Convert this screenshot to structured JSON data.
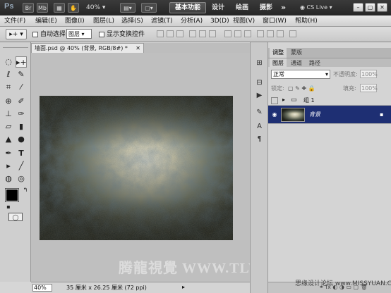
{
  "app": {
    "logo": "Ps",
    "zoom": "40%",
    "workspace_active": "基本功能",
    "workspaces": [
      "设计",
      "绘画",
      "摄影"
    ],
    "more": "»",
    "cs_live": "CS Live"
  },
  "menu": [
    "文件(F)",
    "编辑(E)",
    "图像(I)",
    "图层(L)",
    "选择(S)",
    "滤镜(T)",
    "分析(A)",
    "3D(D)",
    "视图(V)",
    "窗口(W)",
    "帮助(H)"
  ],
  "options": {
    "auto_select_label": "自动选择:",
    "auto_select_value": "图层",
    "show_transform_label": "显示变换控件"
  },
  "document": {
    "tab_title": "墙面.psd @ 40% (背景, RGB/8#) *",
    "zoom": "40%",
    "info": "35 厘米 x 26.25 厘米 (72 ppi)"
  },
  "watermark": "腾龍視覺 WWW.TLVI.NET",
  "watermark_small": "思缘设计论坛 www.MISSYUAN.COM",
  "panel": {
    "top_tabs": [
      "调整",
      "蒙版"
    ],
    "layer_tabs": [
      "图层",
      "通道",
      "路径"
    ],
    "blend_mode": "正常",
    "opacity_label": "不透明度:",
    "opacity": "100%",
    "lock_label": "锁定:",
    "fill_label": "填充:",
    "fill": "100%",
    "layers": [
      {
        "name": "组 1",
        "type": "group"
      },
      {
        "name": "背景",
        "type": "background"
      }
    ]
  }
}
